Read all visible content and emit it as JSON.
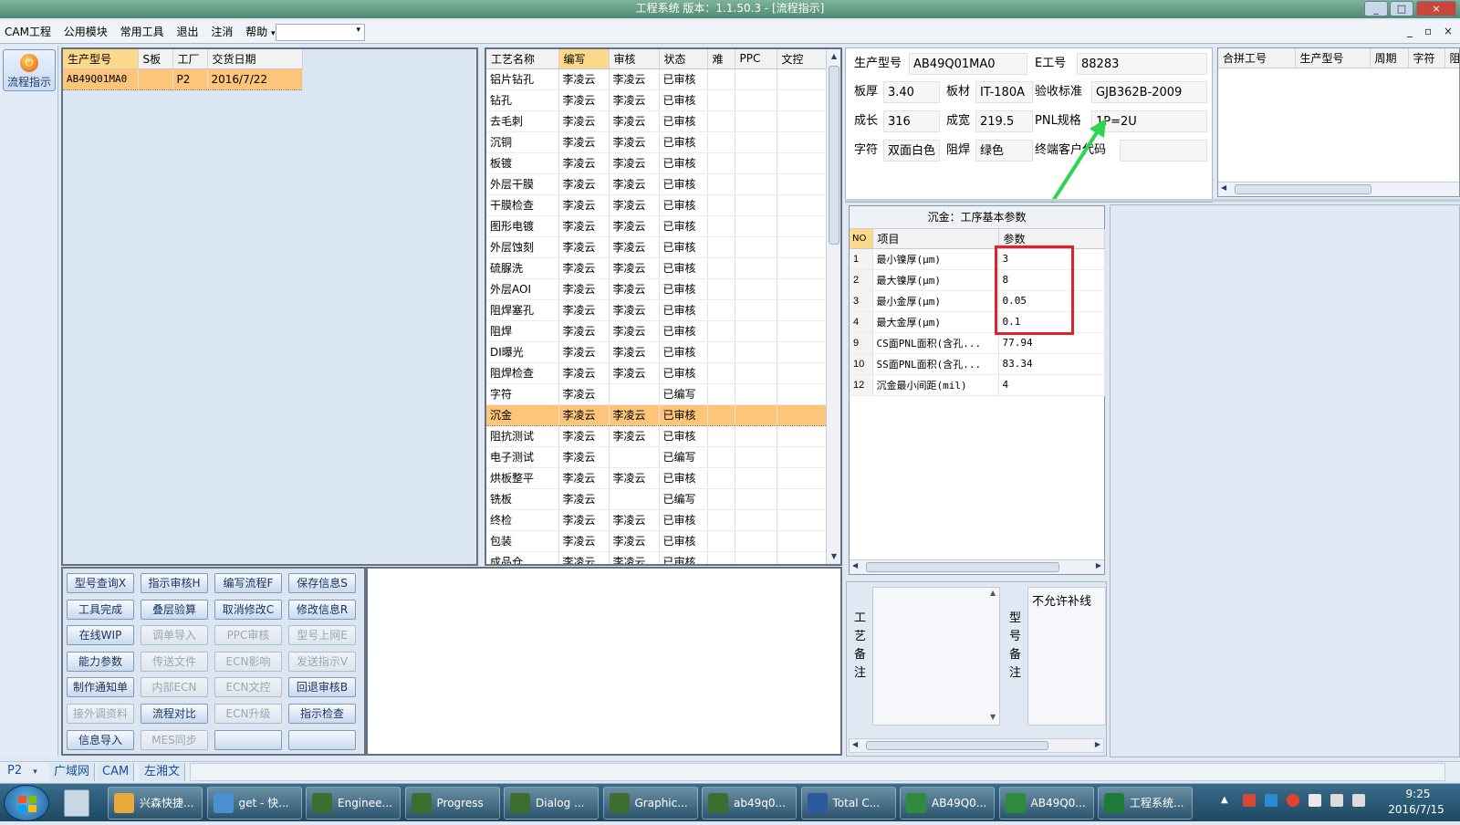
{
  "window": {
    "title": "工程系统   版本：1.1.50.3 - [流程指示]",
    "controls": [
      "_",
      "□",
      "×"
    ]
  },
  "menu": {
    "items": [
      "CAM工程",
      "公用模块",
      "常用工具",
      "退出",
      "注消",
      "帮助"
    ],
    "dropdown_arrow": "▾",
    "mdi_controls": [
      "_",
      "▫",
      "×"
    ]
  },
  "left_toolbar": {
    "button_label": "流程指示"
  },
  "orders": {
    "columns": [
      "生产型号",
      "S板",
      "工厂",
      "交货日期"
    ],
    "rows": [
      {
        "model": "AB49Q01MA0",
        "s": "",
        "factory": "P2",
        "date": "2016/7/22"
      }
    ]
  },
  "process": {
    "columns": [
      "工艺名称",
      "编写",
      "审核",
      "状态",
      "难",
      "PPC",
      "文控"
    ],
    "rows": [
      [
        "铝片钻孔",
        "李凌云",
        "李凌云",
        "已审核"
      ],
      [
        "钻孔",
        "李凌云",
        "李凌云",
        "已审核"
      ],
      [
        "去毛刺",
        "李凌云",
        "李凌云",
        "已审核"
      ],
      [
        "沉铜",
        "李凌云",
        "李凌云",
        "已审核"
      ],
      [
        "板镀",
        "李凌云",
        "李凌云",
        "已审核"
      ],
      [
        "外层干膜",
        "李凌云",
        "李凌云",
        "已审核"
      ],
      [
        "干膜检查",
        "李凌云",
        "李凌云",
        "已审核"
      ],
      [
        "图形电镀",
        "李凌云",
        "李凌云",
        "已审核"
      ],
      [
        "外层蚀刻",
        "李凌云",
        "李凌云",
        "已审核"
      ],
      [
        "硫脲洗",
        "李凌云",
        "李凌云",
        "已审核"
      ],
      [
        "外层AOI",
        "李凌云",
        "李凌云",
        "已审核"
      ],
      [
        "阻焊塞孔",
        "李凌云",
        "李凌云",
        "已审核"
      ],
      [
        "阻焊",
        "李凌云",
        "李凌云",
        "已审核"
      ],
      [
        "DI曝光",
        "李凌云",
        "李凌云",
        "已审核"
      ],
      [
        "阻焊检查",
        "李凌云",
        "李凌云",
        "已审核"
      ],
      [
        "字符",
        "李凌云",
        "",
        "已编写"
      ],
      [
        "沉金",
        "李凌云",
        "李凌云",
        "已审核"
      ],
      [
        "阻抗测试",
        "李凌云",
        "李凌云",
        "已审核"
      ],
      [
        "电子测试",
        "李凌云",
        "",
        "已编写"
      ],
      [
        "烘板整平",
        "李凌云",
        "李凌云",
        "已审核"
      ],
      [
        "铣板",
        "李凌云",
        "",
        "已编写"
      ],
      [
        "终检",
        "李凌云",
        "李凌云",
        "已审核"
      ],
      [
        "包装",
        "李凌云",
        "李凌云",
        "已审核"
      ],
      [
        "成品仓",
        "李凌云",
        "李凌云",
        "已审核"
      ]
    ],
    "selected_index": 16
  },
  "actions": [
    {
      "label": "型号查询X",
      "enabled": true
    },
    {
      "label": "指示审核H",
      "enabled": true
    },
    {
      "label": "编写流程F",
      "enabled": true
    },
    {
      "label": "保存信息S",
      "enabled": true
    },
    {
      "label": "工具完成",
      "enabled": true
    },
    {
      "label": "叠层验算",
      "enabled": true
    },
    {
      "label": "取消修改C",
      "enabled": true
    },
    {
      "label": "修改信息R",
      "enabled": true
    },
    {
      "label": "在线WIP",
      "enabled": true
    },
    {
      "label": "调单导入",
      "enabled": false
    },
    {
      "label": "PPC审核",
      "enabled": false
    },
    {
      "label": "型号上网E",
      "enabled": false
    },
    {
      "label": "能力参数",
      "enabled": true
    },
    {
      "label": "传送文件",
      "enabled": false
    },
    {
      "label": "ECN影响",
      "enabled": false
    },
    {
      "label": "发送指示V",
      "enabled": false
    },
    {
      "label": "制作通知单",
      "enabled": true
    },
    {
      "label": "内部ECN",
      "enabled": false
    },
    {
      "label": "ECN文控",
      "enabled": false
    },
    {
      "label": "回退审核B",
      "enabled": true
    },
    {
      "label": "接外调资料",
      "enabled": false
    },
    {
      "label": "流程对比",
      "enabled": true
    },
    {
      "label": "ECN升级",
      "enabled": false
    },
    {
      "label": "指示检查",
      "enabled": true
    },
    {
      "label": "信息导入",
      "enabled": true
    },
    {
      "label": "MES同步",
      "enabled": false
    },
    {
      "label": "",
      "enabled": true
    },
    {
      "label": "",
      "enabled": true
    }
  ],
  "info": {
    "model_label": "生产型号",
    "model_value": "AB49Q01MA0",
    "e_label": "E工号",
    "e_value": "88283",
    "thickness_label": "板厚",
    "thickness_value": "3.40",
    "material_label": "板材",
    "material_value": "IT-180A",
    "standard_label": "验收标准",
    "standard_value": "GJB362B-2009",
    "length_label": "成长",
    "length_value": "316",
    "width_label": "成宽",
    "width_value": "219.5",
    "pnl_label": "PNL规格",
    "pnl_value": "1P=2U",
    "legend_label": "字符",
    "legend_value": "双面白色",
    "mask_label": "阻焊",
    "mask_value": "绿色",
    "customer_label": "终端客户代码",
    "customer_value": ""
  },
  "merge": {
    "columns": [
      "合拼工号",
      "生产型号",
      "周期",
      "字符",
      "阻焊"
    ]
  },
  "params": {
    "title": "沉金：工序基本参数",
    "columns": [
      "NO",
      "项目",
      "参数"
    ],
    "rows": [
      {
        "no": "1",
        "item": "最小镍厚(μm)",
        "value": "3"
      },
      {
        "no": "2",
        "item": "最大镍厚(μm)",
        "value": "8"
      },
      {
        "no": "3",
        "item": "最小金厚(μm)",
        "value": "0.05"
      },
      {
        "no": "4",
        "item": "最大金厚(μm)",
        "value": "0.1"
      },
      {
        "no": "9",
        "item": "CS面PNL面积(含孔...",
        "value": "77.94"
      },
      {
        "no": "10",
        "item": "SS面PNL面积(含孔...",
        "value": "83.34"
      },
      {
        "no": "12",
        "item": "沉金最小间距(mil)",
        "value": "4"
      }
    ]
  },
  "remarks": {
    "process_label": "工艺备注",
    "process_text": "",
    "model_label": "型号备注",
    "model_text": "不允许补线"
  },
  "statusbar": {
    "factory": "P2",
    "tabs": [
      "广域网",
      "CAM",
      "左湘文"
    ]
  },
  "taskbar": {
    "items": [
      "兴森快捷...",
      "get - 快...",
      "Enginee...",
      "Progress",
      "Dialog ...",
      "Graphic...",
      "ab49q0...",
      "Total C...",
      "AB49Q0...",
      "AB49Q0...",
      "工程系统..."
    ],
    "time": "9:25",
    "date": "2016/7/15",
    "tray_up": "▲"
  },
  "colors": {
    "title_bg": "#4f8a73",
    "selected_row": "#fcc57a",
    "highlight_box": "#e4202d",
    "annotation_arrow": "#2fd44f"
  }
}
